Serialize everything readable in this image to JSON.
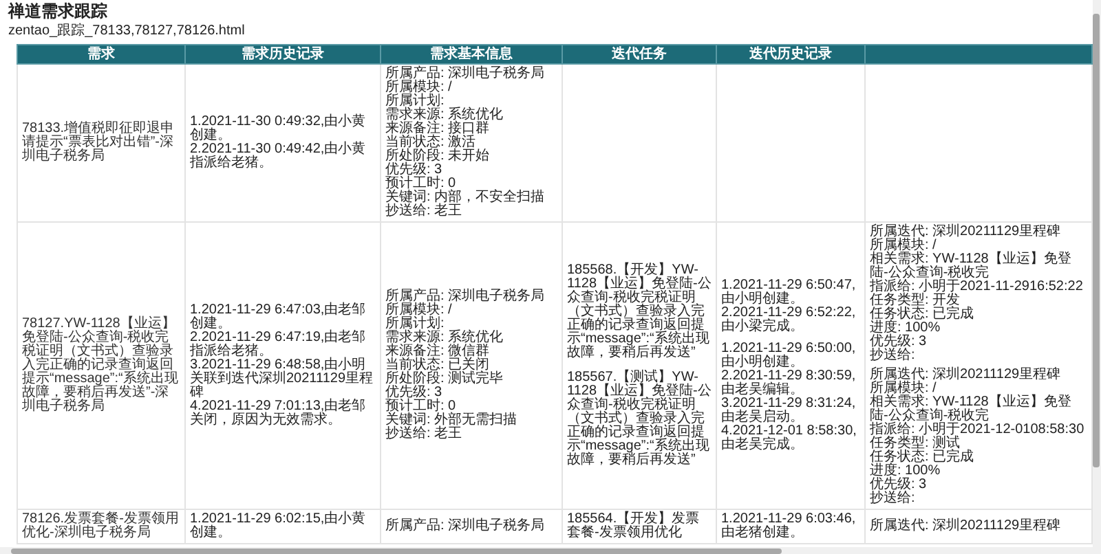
{
  "title": "禅道需求跟踪",
  "filename": "zentao_跟踪_78133,78127,78126.html",
  "columns": [
    "需求",
    "需求历史记录",
    "需求基本信息",
    "迭代任务",
    "迭代历史记录"
  ],
  "rows": [
    {
      "need": "78133.增值税即征即退申请提示“票表比对出错”-深圳电子税务局",
      "history": [
        "1.2021-11-30 0:49:32,由小黄创建。",
        "2.2021-11-30 0:49:42,由小黄指派给老猪。"
      ],
      "info": [
        "所属产品: 深圳电子税务局",
        "所属模块: /",
        "所属计划:",
        "需求来源: 系统优化",
        "来源备注: 接口群",
        "当前状态: 激活",
        "所处阶段: 未开始",
        "优先级: 3",
        "预计工时: 0",
        "关键词: 内部，不安全扫描",
        "抄送给: 老王"
      ],
      "tasks": []
    },
    {
      "need": "78127.YW-1128【业运】免登陆-公众查询-税收完税证明（文书式）查验录入完正确的记录查询返回提示“message”:“系统出现故障，要稍后再发送”-深圳电子税务局",
      "history": [
        "1.2021-11-29 6:47:03,由老邹创建。",
        "2.2021-11-29 6:47:19,由老邹指派给老猪。",
        "3.2021-11-29 6:48:58,由小明关联到迭代深圳20211129里程碑",
        "4.2021-11-29 7:01:13,由老邹关闭，原因为无效需求。"
      ],
      "info": [
        "所属产品: 深圳电子税务局",
        "所属模块: /",
        "所属计划:",
        "需求来源: 系统优化",
        "来源备注: 微信群",
        "当前状态: 已关闭",
        "所处阶段: 测试完毕",
        "优先级: 3",
        "预计工时: 0",
        "关键词: 外部无需扫描",
        "抄送给: 老王"
      ],
      "tasks": [
        {
          "text": "185568.【开发】YW-1128【业运】免登陆-公众查询-税收完税证明（文书式）查验录入完正确的记录查询返回提示“message”:“系统出现故障，要稍后再发送”",
          "history": [
            "1.2021-11-29 6:50:47,由小明创建。",
            "2.2021-11-29 6:52:22,由小梁完成。"
          ],
          "info": [
            "所属迭代: 深圳20211129里程碑",
            "所属模块: /",
            "相关需求: YW-1128【业运】免登陆-公众查询-税收完",
            "指派给: 小明于2021-11-2916:52:22",
            "任务类型: 开发",
            "任务状态: 已完成",
            "进度: 100%",
            "优先级: 3",
            "抄送给:"
          ]
        },
        {
          "text": "185567.【测试】YW-1128【业运】免登陆-公众查询-税收完税证明（文书式）查验录入完正确的记录查询返回提示“message”:“系统出现故障，要稍后再发送”",
          "history": [
            "1.2021-11-29 6:50:00,由小明创建。",
            "2.2021-11-29 8:30:59,由老吴编辑。",
            "3.2021-11-29 8:31:24,由老吴启动。",
            "4.2021-12-01 8:58:30,由老吴完成。"
          ],
          "info": [
            "所属迭代: 深圳20211129里程碑",
            "所属模块: /",
            "相关需求: YW-1128【业运】免登陆-公众查询-税收完",
            "指派给: 小明于2021-12-0108:58:30",
            "任务类型: 测试",
            "任务状态: 已完成",
            "进度: 100%",
            "优先级: 3",
            "抄送给:"
          ]
        }
      ]
    },
    {
      "need": "78126.发票套餐-发票领用优化-深圳电子税务局",
      "history": [
        "1.2021-11-29 6:02:15,由小黄创建。"
      ],
      "info": [
        "所属产品: 深圳电子税务局"
      ],
      "tasks": [
        {
          "text": "185564.【开发】发票套餐-发票领用优化",
          "history": [
            "1.2021-11-29 6:03:46,由老猪创建。"
          ],
          "info": [
            "所属迭代: 深圳20211129里程碑"
          ]
        }
      ]
    }
  ]
}
